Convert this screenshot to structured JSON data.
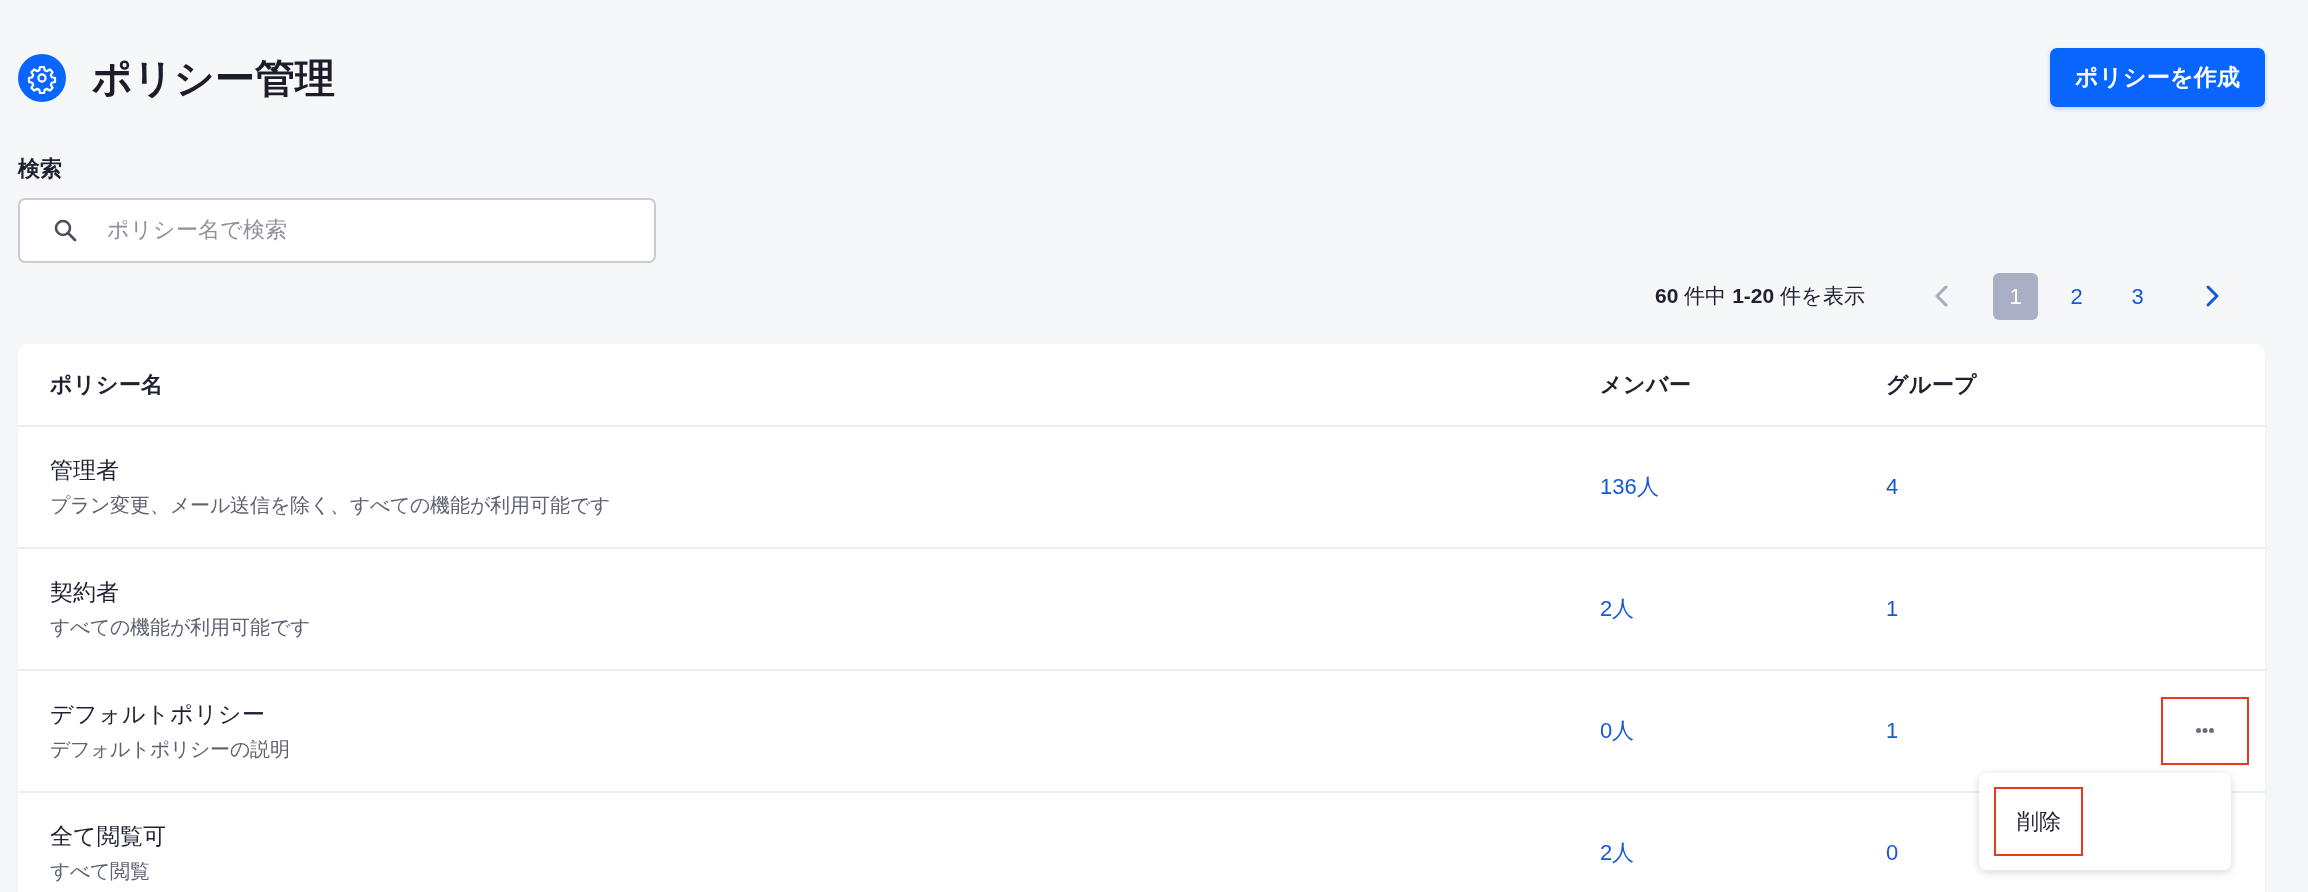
{
  "header": {
    "title": "ポリシー管理",
    "create_button": "ポリシーを作成"
  },
  "search": {
    "label": "検索",
    "placeholder": "ポリシー名で検索"
  },
  "pagination": {
    "summary": "**60** 件中 **1-20** 件を表示",
    "prev": {
      "disabled": true
    },
    "pages": [
      {
        "label": "1",
        "selected": true
      },
      {
        "label": "2",
        "selected": false
      },
      {
        "label": "3",
        "selected": false
      }
    ],
    "next": {
      "disabled": false
    }
  },
  "table": {
    "columns": [
      "ポリシー名",
      "メンバー",
      "グループ"
    ],
    "rows": [
      {
        "name": "管理者",
        "description": "プラン変更、メール送信を除く、すべての機能が利用可能です",
        "members": "136人",
        "groups": "4"
      },
      {
        "name": "契約者",
        "description": "すべての機能が利用可能です",
        "members": "2人",
        "groups": "1"
      },
      {
        "name": "デフォルトポリシー",
        "description": "デフォルトポリシーの説明",
        "members": "0人",
        "groups": "1",
        "more_button": {
          "highlighted": true
        },
        "menu": {
          "items": [
            {
              "label": "削除",
              "highlighted": true
            }
          ]
        }
      },
      {
        "name": "全て閲覧可",
        "description": "すべて閲覧",
        "members": "2人",
        "groups": "0"
      }
    ]
  }
}
